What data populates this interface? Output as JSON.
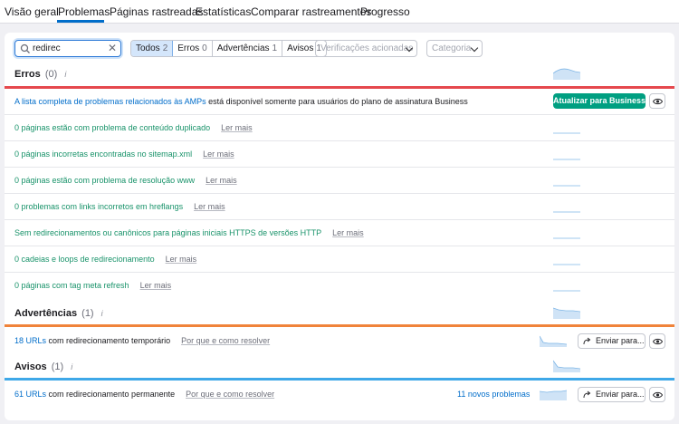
{
  "tabs": [
    "Visão geral",
    "Problemas",
    "Páginas rastreadas",
    "Estatísticas",
    "Comparar rastreamentos",
    "Progresso"
  ],
  "search": {
    "value": "redirec",
    "placeholder": ""
  },
  "filters": [
    {
      "label": "Todos",
      "count": "2"
    },
    {
      "label": "Erros",
      "count": "0"
    },
    {
      "label": "Advertências",
      "count": "1"
    },
    {
      "label": "Avisos",
      "count": "1"
    }
  ],
  "dropdowns": {
    "checks": "Verificações acionadas",
    "category": "Categoria"
  },
  "errors": {
    "title": "Erros",
    "count": "(0)",
    "info": "i",
    "banner": {
      "link": "A lista completa de problemas relacionados às AMPs",
      "rest": " está disponível somente para usuários do plano de assinatura Business",
      "button": "Atualizar para Business"
    },
    "items": [
      {
        "text": "0 páginas estão com problema de conteúdo duplicado",
        "more": "Ler mais"
      },
      {
        "text": "0 páginas incorretas encontradas no sitemap.xml",
        "more": "Ler mais"
      },
      {
        "text": "0 páginas estão com problema de resolução www",
        "more": "Ler mais"
      },
      {
        "text": "0 problemas com links incorretos em hreflangs",
        "more": "Ler mais"
      },
      {
        "text": "Sem redirecionamentos ou canônicos para páginas iniciais HTTPS de versões HTTP",
        "more": "Ler mais"
      },
      {
        "text": "0 cadeias e loops de redirecionamento",
        "more": "Ler mais"
      },
      {
        "text": "0 páginas com tag meta refresh",
        "more": "Ler mais"
      }
    ]
  },
  "warnings": {
    "title": "Advertências",
    "count": "(1)",
    "info": "i",
    "item": {
      "link": "18 URLs",
      "rest": " com redirecionamento temporário",
      "more": "Por que e como resolver",
      "send": "Enviar para..."
    }
  },
  "notices": {
    "title": "Avisos",
    "count": "(1)",
    "info": "i",
    "item": {
      "link": "61 URLs",
      "rest": " com redirecionamento permanente",
      "more": "Por que e como resolver",
      "new": "11 novos problemas",
      "send": "Enviar para..."
    }
  },
  "colors": {
    "errors": "#e5484d",
    "warnings": "#f0833a",
    "notices": "#3ea8e8",
    "accent": "#006dca",
    "green": "#009f81"
  },
  "icons": [
    "search-icon",
    "close-icon",
    "chevron-down-icon",
    "info-icon",
    "eye-icon",
    "share-arrow-icon"
  ]
}
